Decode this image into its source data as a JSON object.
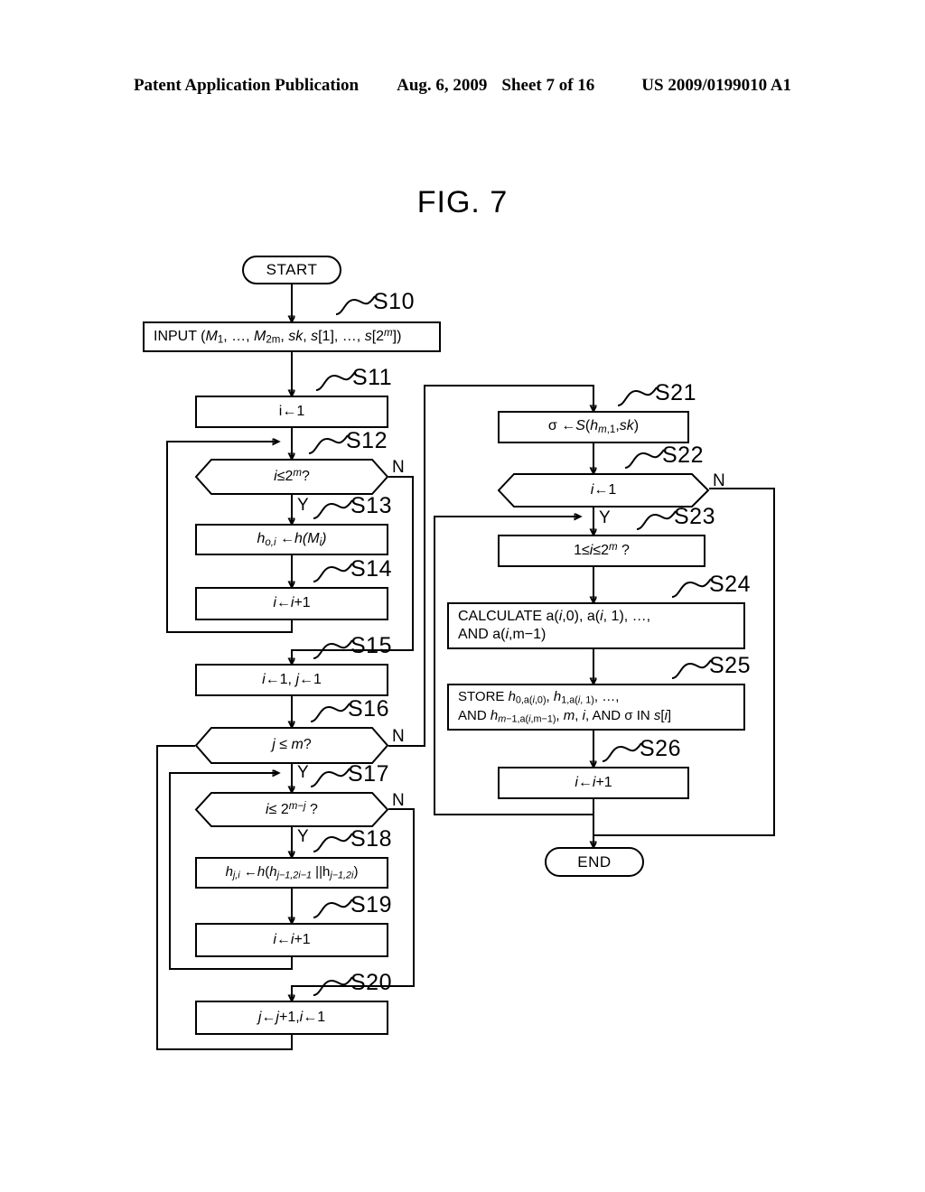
{
  "header": {
    "publication": "Patent Application Publication",
    "date": "Aug. 6, 2009",
    "sheet": "Sheet 7 of 16",
    "doc_number": "US 2009/0199010 A1"
  },
  "figure": {
    "title": "FIG. 7"
  },
  "terminals": {
    "start": "START",
    "end": "END"
  },
  "branch_labels": {
    "yes": "Y",
    "no": "N"
  },
  "steps": [
    {
      "id": "S10",
      "label": "S10",
      "shape": "rect",
      "text": "INPUT (M1, …, M2m, sk, s[1], …, s[2m])"
    },
    {
      "id": "S11",
      "label": "S11",
      "shape": "rect",
      "text": "i←1"
    },
    {
      "id": "S12",
      "label": "S12",
      "shape": "decision",
      "text": "i≤2m?"
    },
    {
      "id": "S13",
      "label": "S13",
      "shape": "rect",
      "text": "ho,i ←h(Mi)"
    },
    {
      "id": "S14",
      "label": "S14",
      "shape": "rect",
      "text": "i←i+1"
    },
    {
      "id": "S15",
      "label": "S15",
      "shape": "rect",
      "text": "i←1, j←1"
    },
    {
      "id": "S16",
      "label": "S16",
      "shape": "decision",
      "text": "j ≤ m?"
    },
    {
      "id": "S17",
      "label": "S17",
      "shape": "decision",
      "text": "i≤ 2m−j ?"
    },
    {
      "id": "S18",
      "label": "S18",
      "shape": "rect",
      "text": "hj,i ←h(hj−1,2i−1 ||hj−1,2i)"
    },
    {
      "id": "S19",
      "label": "S19",
      "shape": "rect",
      "text": "i←i+1"
    },
    {
      "id": "S20",
      "label": "S20",
      "shape": "rect",
      "text": "j←j+1, i←1"
    },
    {
      "id": "S21",
      "label": "S21",
      "shape": "rect",
      "text": "σ ←S(hm,1,sk)"
    },
    {
      "id": "S22",
      "label": "S22",
      "shape": "decision",
      "text": "i←1"
    },
    {
      "id": "S23",
      "label": "S23",
      "shape": "rect",
      "text": "1≤i≤2m ?"
    },
    {
      "id": "S24",
      "label": "S24",
      "shape": "rect",
      "text": "CALCULATE a(i,0), a(i, 1), …, AND a(i,m−1)"
    },
    {
      "id": "S25",
      "label": "S25",
      "shape": "rect",
      "text": "STORE h0,a(i,0), h1,a(i, 1), …, AND hm−1,a(i,m−1), m, i, AND σ IN s[i]"
    },
    {
      "id": "S26",
      "label": "S26",
      "shape": "rect",
      "text": "i←i+1"
    }
  ],
  "colors": {
    "ink": "#000000",
    "paper": "#ffffff"
  }
}
